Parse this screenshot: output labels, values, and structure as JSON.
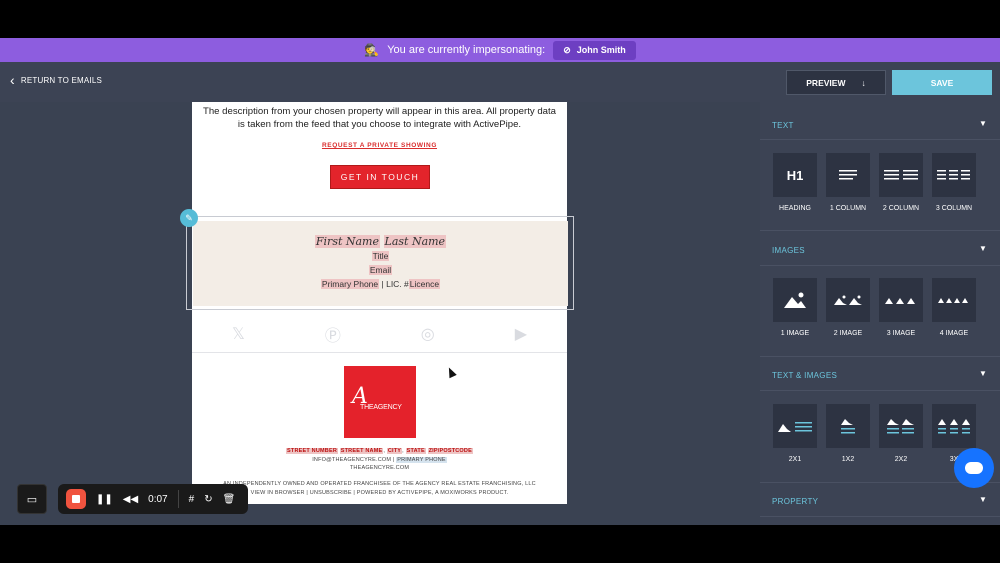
{
  "impersonation": {
    "text": "You are currently impersonating:",
    "user": "John Smith"
  },
  "header": {
    "back_label": "RETURN TO EMAILS",
    "preview_label": "PREVIEW",
    "save_label": "SAVE"
  },
  "email": {
    "description": "The description from your chosen property will appear in this area. All property data is taken from the feed that you choose to integrate with ActivePipe.",
    "request_link": "REQUEST A PRIVATE SHOWING",
    "cta_label": "GET IN TOUCH",
    "signature": {
      "first_name": "First Name",
      "last_name": "Last Name",
      "title": "Title",
      "email": "Email",
      "phone": "Primary Phone",
      "lic_text": "| LIC. #",
      "licence": "Licence"
    },
    "logo_mark": "A",
    "logo_text": "THEAGENCY",
    "address": {
      "street_number": "STREET NUMBER",
      "street_name": "STREET NAME",
      "city": "CITY",
      "state": "STATE",
      "zip": "ZIP/POSTCODE",
      "email": "INFO@THEAGENCYRE.COM",
      "phone": "PRIMARY PHONE",
      "website": "THEAGENCYRE.COM",
      "franchise": "AN INDEPENDENTLY OWNED AND OPERATED FRANCHISEE OF THE AGENCY REAL ESTATE FRANCHISING, LLC",
      "footer_links": "VIEW IN BROWSER  |  UNSUBSCRIBE | POWERED BY ACTIVEPIPE, A MOXIWORKS PRODUCT."
    }
  },
  "sidebar": {
    "sections": [
      {
        "title": "TEXT",
        "tiles": [
          {
            "label": "HEADING",
            "glyph": "H1"
          },
          {
            "label": "1 COLUMN"
          },
          {
            "label": "2 COLUMN"
          },
          {
            "label": "3 COLUMN"
          }
        ]
      },
      {
        "title": "IMAGES",
        "tiles": [
          {
            "label": "1 IMAGE"
          },
          {
            "label": "2 IMAGE"
          },
          {
            "label": "3 IMAGE"
          },
          {
            "label": "4 IMAGE"
          }
        ]
      },
      {
        "title": "TEXT & IMAGES",
        "tiles": [
          {
            "label": "2X1"
          },
          {
            "label": "1X2"
          },
          {
            "label": "2X2"
          },
          {
            "label": "3X"
          }
        ]
      },
      {
        "title": "PROPERTY"
      }
    ]
  },
  "recorder": {
    "time": "0:07"
  },
  "colors": {
    "accent": "#6cc5dc",
    "impersonation": "#8d5ddf",
    "brand_red": "#e4222b",
    "chat": "#1673ff"
  }
}
